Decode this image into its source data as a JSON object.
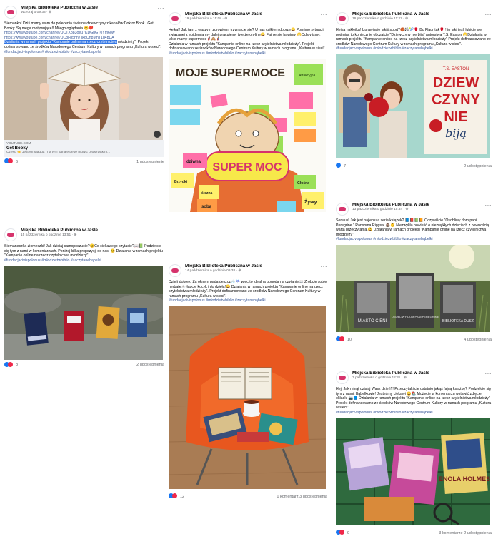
{
  "page_name": "Miejska Biblioteka Publiczna w Jaśle",
  "more_glyph": "···",
  "posts": [
    {
      "date": "Wczoraj o 09:33 · ⊕",
      "text": "Siemanko! Dziś mamy wam do polecenia świetne dziewczyny z kanałów Doktor Book i Get Booky. Są mega motywujące!! Miłego oglądania 😀❤️",
      "links": [
        "https://www.youtube.com/channel/UCTX883oeu7KDGnGT0Ym6ow",
        "https://www.youtube.com/channel/UC8Fb5hn7skdQn89mT1q4pDA"
      ],
      "highlight": "Działania w ramach projektu \"Kampanie online na rzecz czytelnictwa",
      "after": "młodzieży\". Projekt dofinansowano ze środków Narodowego Centrum Kultury w ramach programu „Kultura w sieci\".",
      "tags": "#fundacjacivispolonus #młodzieżwbiblio #zaczytanebąbelki",
      "yt_source": "YOUTUBE.COM",
      "yt_title": "Get Booky",
      "yt_desc": "Cześć 👋 Jestem Magda i na tym kanale będę mówić o wszystkim...",
      "reactions": "6",
      "shares": "1 udostępnienie"
    },
    {
      "date": "19 października o 15:08 · ⊕",
      "text": "Hejka!! Jak tam z waszym zdrowiem, trzymacie się? U nas całkiem dobrze😀 Pomimo sytuacji związanej z epidemią my dalej pracujemy tyle że on-line😀 Fajnie się bawimy 😁Odkryliśmy, jakie mamy supermoce🦸‍♀️🙈🦸",
      "after": "Działania w ramach projektu \"Kampanie online na rzecz czytelnictwa młodzieży\". Projekt dofinansowano ze środków Narodowego Centrum Kultury w ramach programu „Kultura w sieci\".",
      "tags": "#fundacjacivispolonus #młodzieżwbiblio #zaczytanebąbelki",
      "poster_title": "MOJE SUPERMOCE",
      "poster_center": "SUPER MOC",
      "notes": [
        "Atrakcyjna",
        "Mądra",
        "Zdolna",
        "Uśmiechnięta",
        "Wesoła",
        "Pomocna",
        "Kreatywna",
        "Zabawna",
        "Optymistka",
        "Miła",
        "dziwna",
        "Głośna",
        "Brzydki",
        "ślczna",
        "sobą",
        "Żywy",
        "pani dziarska",
        "Mądry"
      ],
      "reactions": "12",
      "comments": "1 komentarz  3 udostępnienia"
    },
    {
      "date": "16 października o godzinie 11:27 · ⊕",
      "text": "Hejka naklejka! Uprawiacie jakiś sport?🏀⚽🎾🥊 Bo Flaur tak🥊 ! to jaki jeśli lubicie się pośmiać to koniecznie obczajcie \"Dziewczyny nie biją\" autorstwa T.S. Easton 😁Działania w ramach projektu \"Kampanie online na rzecz czytelnictwa młodzieży\" Projekt dofinansowano ze środków Narodowego Centrum Kultury w ramach programu „Kultura w sieci\".",
      "tags": "#fundacjacivispolonus #młodzieżwbiblio #zaczytanebąbelki",
      "book_author": "T.S. EASTON",
      "book_title_1": "DZIEW",
      "book_title_2": "CZYNY",
      "book_title_3": "NIE",
      "book_title_4": "biją",
      "reactions": "7",
      "shares": "2 udostępnienia"
    },
    {
      "date": "15 października o godzinie 13:51 · ⊕",
      "text": "Siemaneczka ziomeczki! Jak dzisiaj samopoczucie?😊Co ciekawego czytacie?📖📗 Podzielcie się tym z nami w komentarzach. Poniżej kilka propozycji od nas. 🙂 Działania w ramach projektu \"Kampanie online na rzecz czytelnictwa młodzieży\"",
      "tags": "#fundacjacivispolonus #młodzieżwbiblio #zaczytanebąbelki",
      "reactions": "8",
      "shares": "2 udostępnienia"
    },
    {
      "date": "13 października o godzinie 15:34 · ⊕",
      "text": "Serwus! Jak jest najlepsza seria książek? 📘📕📗📙 Oczywiście \"Osobliwy dom pani Peregrine \" Ransoma Riggsa! 🏚️👶 Niezwykła powieść o niezwykłych dzieciach z pewnością warta przeczytania.😀 Działania w ramach projektu \"Kampanie online na rzecz czytelnictwa młodzieży\"",
      "tags": "#fundacjacivispolonus #młodzieżwbiblio #zaczytanebąbelki",
      "book_a": "MIASTO CIENI",
      "book_b": "OSOBLIWY DOM PANI PEREGRINE",
      "book_c": "BIBLIOTEKA DUSZ",
      "reactions": "10",
      "shares": "4 udostępnienia"
    },
    {
      "date": "14 października o godzinie 09:38 · ⊕",
      "text": "Dzień dobrek! Za oknem pada deszcz🌧️☔ więc to idealna pogoda na czytanie📖 Zróbcie sobie herbatę☕ łapcie kocyk i do dzieła!😀 Działania w ramach projektu \"Kampanie online na rzecz czytelnictwa młodzieży\". Projekt dofinansowano ze środków Narodowego Centrum Kultury w ramach programu „Kultura w sieci\".",
      "tags": "#fundacjacivispolonus #młodzieżwbiblio #zaczytanebąbelki",
      "reactions": "12",
      "comments": "1 komentarz  3 udostępnienia"
    },
    {
      "date": "7 października o godzinie 12:31 · ⊕",
      "text": "Hej! Jak minął dzisiaj Wasz dzień?! Przeczytaliście ostatnio jakąś fajną książkę? Podzielcie się tym z nami. Bąbelkowie! Jesteśmy ciekawi 😀📚 Możecie w komentarzu wstawić zdjęcie okładki 📷📘 Działania w ramach projektu \"Kampanie online na rzecz czytelnictwa młodzieży\" Projekt dofinansowano ze środków Narodowego Centrum Kultury w ramach programu „Kultura w sieci\".",
      "tags": "#fundacjacivispolonus #młodzieżwbiblio #zaczytanebąbelki",
      "book_d": "ENOLA HOLMES",
      "reactions": "9",
      "comments": "3 komentarze  2 udostępnienia"
    }
  ]
}
